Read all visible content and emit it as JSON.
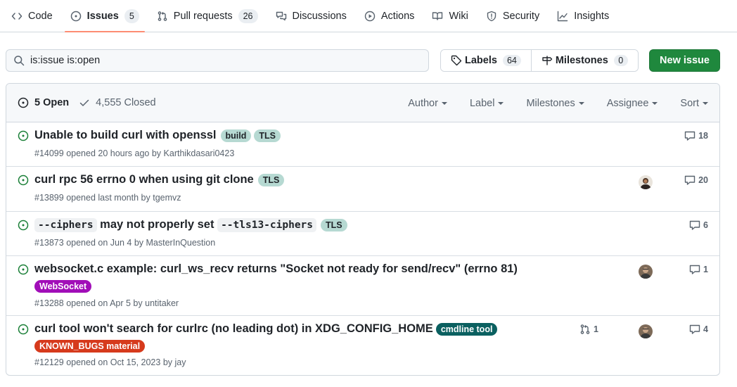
{
  "nav": {
    "tabs": [
      {
        "label": "Code",
        "icon": "code-icon"
      },
      {
        "label": "Issues",
        "count": "5",
        "icon": "issue-opened-icon",
        "active": true
      },
      {
        "label": "Pull requests",
        "count": "26",
        "icon": "git-pull-request-icon"
      },
      {
        "label": "Discussions",
        "icon": "comment-discussion-icon"
      },
      {
        "label": "Actions",
        "icon": "play-icon"
      },
      {
        "label": "Wiki",
        "icon": "book-icon"
      },
      {
        "label": "Security",
        "icon": "shield-icon"
      },
      {
        "label": "Insights",
        "icon": "graph-icon"
      }
    ]
  },
  "search": {
    "value": "is:issue is:open"
  },
  "labels_button": {
    "label": "Labels",
    "count": "64"
  },
  "milestones_button": {
    "label": "Milestones",
    "count": "0"
  },
  "new_issue_button": {
    "label": "New issue"
  },
  "header": {
    "open_label": "5 Open",
    "closed_label": "4,555 Closed",
    "filters": [
      "Author",
      "Label",
      "Milestones",
      "Assignee",
      "Sort"
    ]
  },
  "issues": [
    {
      "title": "Unable to build curl with openssl",
      "labels": [
        {
          "name": "build",
          "color": "#b6d9d2",
          "text": "#1f2328"
        },
        {
          "name": "TLS",
          "color": "#b6d9d2",
          "text": "#1f2328"
        }
      ],
      "meta_number": "#14099",
      "meta_text": "opened 20 hours ago by",
      "author": "Karthikdasari0423",
      "comments": "18"
    },
    {
      "title": "curl rpc 56 errno 0 when using git clone",
      "labels": [
        {
          "name": "TLS",
          "color": "#b6d9d2",
          "text": "#1f2328"
        }
      ],
      "meta_number": "#13899",
      "meta_text": "opened last month by",
      "author": "tgemvz",
      "comments": "20"
    },
    {
      "title_parts": [
        "--ciphers",
        "may not properly set",
        "--tls13-ciphers"
      ],
      "labels": [
        {
          "name": "TLS",
          "color": "#b6d9d2",
          "text": "#1f2328"
        }
      ],
      "meta_number": "#13873",
      "meta_text": "opened on Jun 4 by",
      "author": "MasterInQuestion",
      "comments": "6"
    },
    {
      "title": "websocket.c example: curl_ws_recv returns \"Socket not ready for send/recv\" (errno 81)",
      "labels": [
        {
          "name": "WebSocket",
          "color": "#a10eb8",
          "text": "#ffffff"
        }
      ],
      "meta_number": "#13288",
      "meta_text": "opened on Apr 5 by",
      "author": "untitaker",
      "comments": "1"
    },
    {
      "title": "curl tool won't search for curlrc (no leading dot) in XDG_CONFIG_HOME",
      "labels": [
        {
          "name": "cmdline tool",
          "color": "#0b6060",
          "text": "#ffffff"
        },
        {
          "name": "KNOWN_BUGS material",
          "color": "#d63a1c",
          "text": "#ffffff"
        }
      ],
      "meta_number": "#12129",
      "meta_text": "opened on Oct 15, 2023 by",
      "author": "jay",
      "linked_prs": "1",
      "comments": "4"
    }
  ],
  "colors": {
    "open": "#1a7f37",
    "accent_underline": "#fd8c73",
    "primary_button": "#1f883d"
  }
}
